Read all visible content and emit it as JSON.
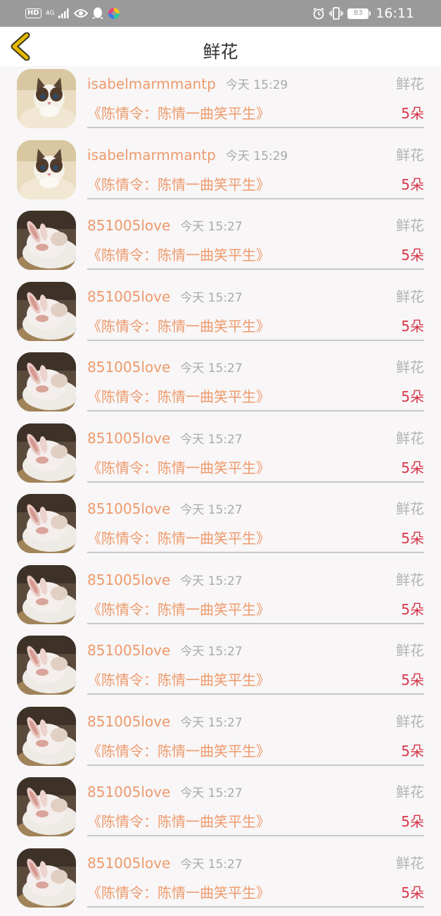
{
  "status_bar": {
    "hd": "HD",
    "network": "4G",
    "battery": "83",
    "time": "16:11"
  },
  "header": {
    "title": "鲜花"
  },
  "items": [
    {
      "username": "isabelmarmmantp",
      "time": "今天 15:29",
      "type": "鲜花",
      "work": "《陈情令：陈情一曲笑平生》",
      "count": "5朵",
      "avatar": "cat-avatar"
    },
    {
      "username": "isabelmarmmantp",
      "time": "今天 15:29",
      "type": "鲜花",
      "work": "《陈情令：陈情一曲笑平生》",
      "count": "5朵",
      "avatar": "cat-avatar"
    },
    {
      "username": "851005love",
      "time": "今天 15:27",
      "type": "鲜花",
      "work": "《陈情令：陈情一曲笑平生》",
      "count": "5朵",
      "avatar": "bunny-avatar"
    },
    {
      "username": "851005love",
      "time": "今天 15:27",
      "type": "鲜花",
      "work": "《陈情令：陈情一曲笑平生》",
      "count": "5朵",
      "avatar": "bunny-avatar"
    },
    {
      "username": "851005love",
      "time": "今天 15:27",
      "type": "鲜花",
      "work": "《陈情令：陈情一曲笑平生》",
      "count": "5朵",
      "avatar": "bunny-avatar"
    },
    {
      "username": "851005love",
      "time": "今天 15:27",
      "type": "鲜花",
      "work": "《陈情令：陈情一曲笑平生》",
      "count": "5朵",
      "avatar": "bunny-avatar"
    },
    {
      "username": "851005love",
      "time": "今天 15:27",
      "type": "鲜花",
      "work": "《陈情令：陈情一曲笑平生》",
      "count": "5朵",
      "avatar": "bunny-avatar"
    },
    {
      "username": "851005love",
      "time": "今天 15:27",
      "type": "鲜花",
      "work": "《陈情令：陈情一曲笑平生》",
      "count": "5朵",
      "avatar": "bunny-avatar"
    },
    {
      "username": "851005love",
      "time": "今天 15:27",
      "type": "鲜花",
      "work": "《陈情令：陈情一曲笑平生》",
      "count": "5朵",
      "avatar": "bunny-avatar"
    },
    {
      "username": "851005love",
      "time": "今天 15:27",
      "type": "鲜花",
      "work": "《陈情令：陈情一曲笑平生》",
      "count": "5朵",
      "avatar": "bunny-avatar"
    },
    {
      "username": "851005love",
      "time": "今天 15:27",
      "type": "鲜花",
      "work": "《陈情令：陈情一曲笑平生》",
      "count": "5朵",
      "avatar": "bunny-avatar"
    },
    {
      "username": "851005love",
      "time": "今天 15:27",
      "type": "鲜花",
      "work": "《陈情令：陈情一曲笑平生》",
      "count": "5朵",
      "avatar": "bunny-avatar"
    }
  ],
  "colors": {
    "accent": "#ee9a6c",
    "count": "#d8364a",
    "back_arrow": "#e6b800"
  }
}
